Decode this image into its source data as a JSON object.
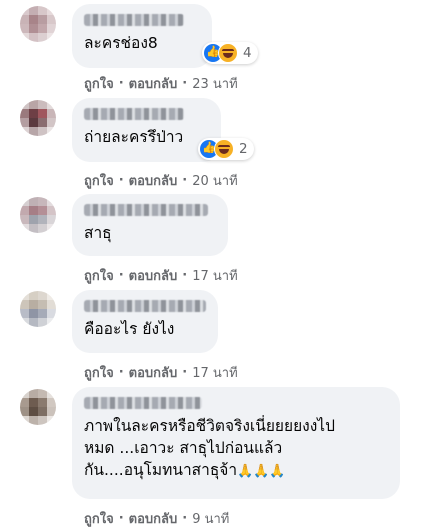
{
  "labels": {
    "like": "ถูกใจ",
    "reply": "ตอบกลับ",
    "sep": "·"
  },
  "comments": [
    {
      "text": "ละครช่อง8",
      "reaction_count": "4",
      "time": "23 นาที"
    },
    {
      "text": "ถ่ายละครรึป่าว",
      "reaction_count": "2",
      "time": "20 นาที"
    },
    {
      "text": "สาธุ",
      "time": "17 นาที"
    },
    {
      "text": "คืออะไร ยังไง",
      "time": "17 นาที"
    },
    {
      "text": "ภาพในละครหรือชีวิตจริงเนี่ยยยยงงไป\nหมด ...เอาวะ สาธุไปก่อนแล้ว\nกัน....อนุโมทนาสาธุจ้า",
      "emoji": "🙏🙏🙏",
      "time": "9 นาที"
    }
  ],
  "reaction_icons": [
    "like-icon",
    "haha-icon"
  ],
  "colors": {
    "bubble": "#f0f2f5",
    "meta": "#65676b",
    "like": "#1877f2",
    "haha": "#f7b125"
  }
}
